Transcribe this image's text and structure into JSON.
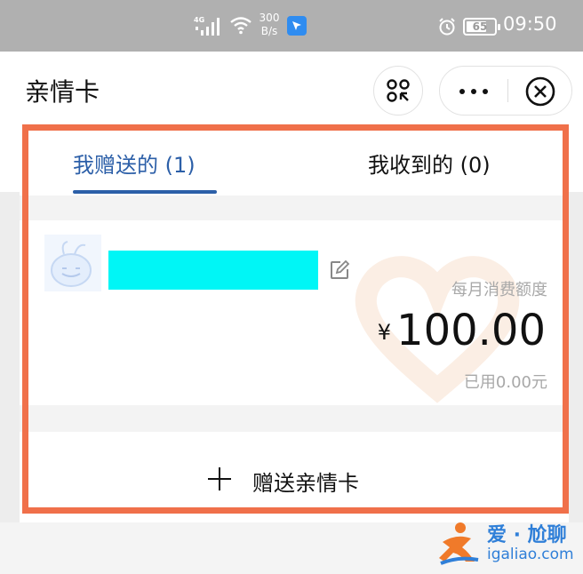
{
  "status_bar": {
    "network_label": "4G",
    "speed_value": "300",
    "speed_unit": "B/s",
    "battery": "65",
    "time": "09:50"
  },
  "header": {
    "title": "亲情卡"
  },
  "tabs": [
    {
      "label": "我赠送的 (1)",
      "active": true
    },
    {
      "label": "我收到的 (0)",
      "active": false
    }
  ],
  "card": {
    "quota_label": "每月消费额度",
    "currency": "¥",
    "amount": "100.00",
    "used": "已用0.00元"
  },
  "gift_action": {
    "label": "赠送亲情卡"
  },
  "watermark": {
    "title": "爱 · 尬聊",
    "url": "igaliao.com"
  },
  "colors": {
    "accent": "#2c5fa8",
    "highlight": "#f0704a",
    "redacted": "#00f6f6",
    "watermark": "#2f7fd8"
  },
  "icons": [
    "signal-icon",
    "wifi-icon",
    "app-notification-icon",
    "alarm-icon",
    "battery-icon",
    "qr-scan-icon",
    "more-icon",
    "close-icon",
    "avatar-icon",
    "edit-icon",
    "plus-icon",
    "watermark-logo"
  ]
}
